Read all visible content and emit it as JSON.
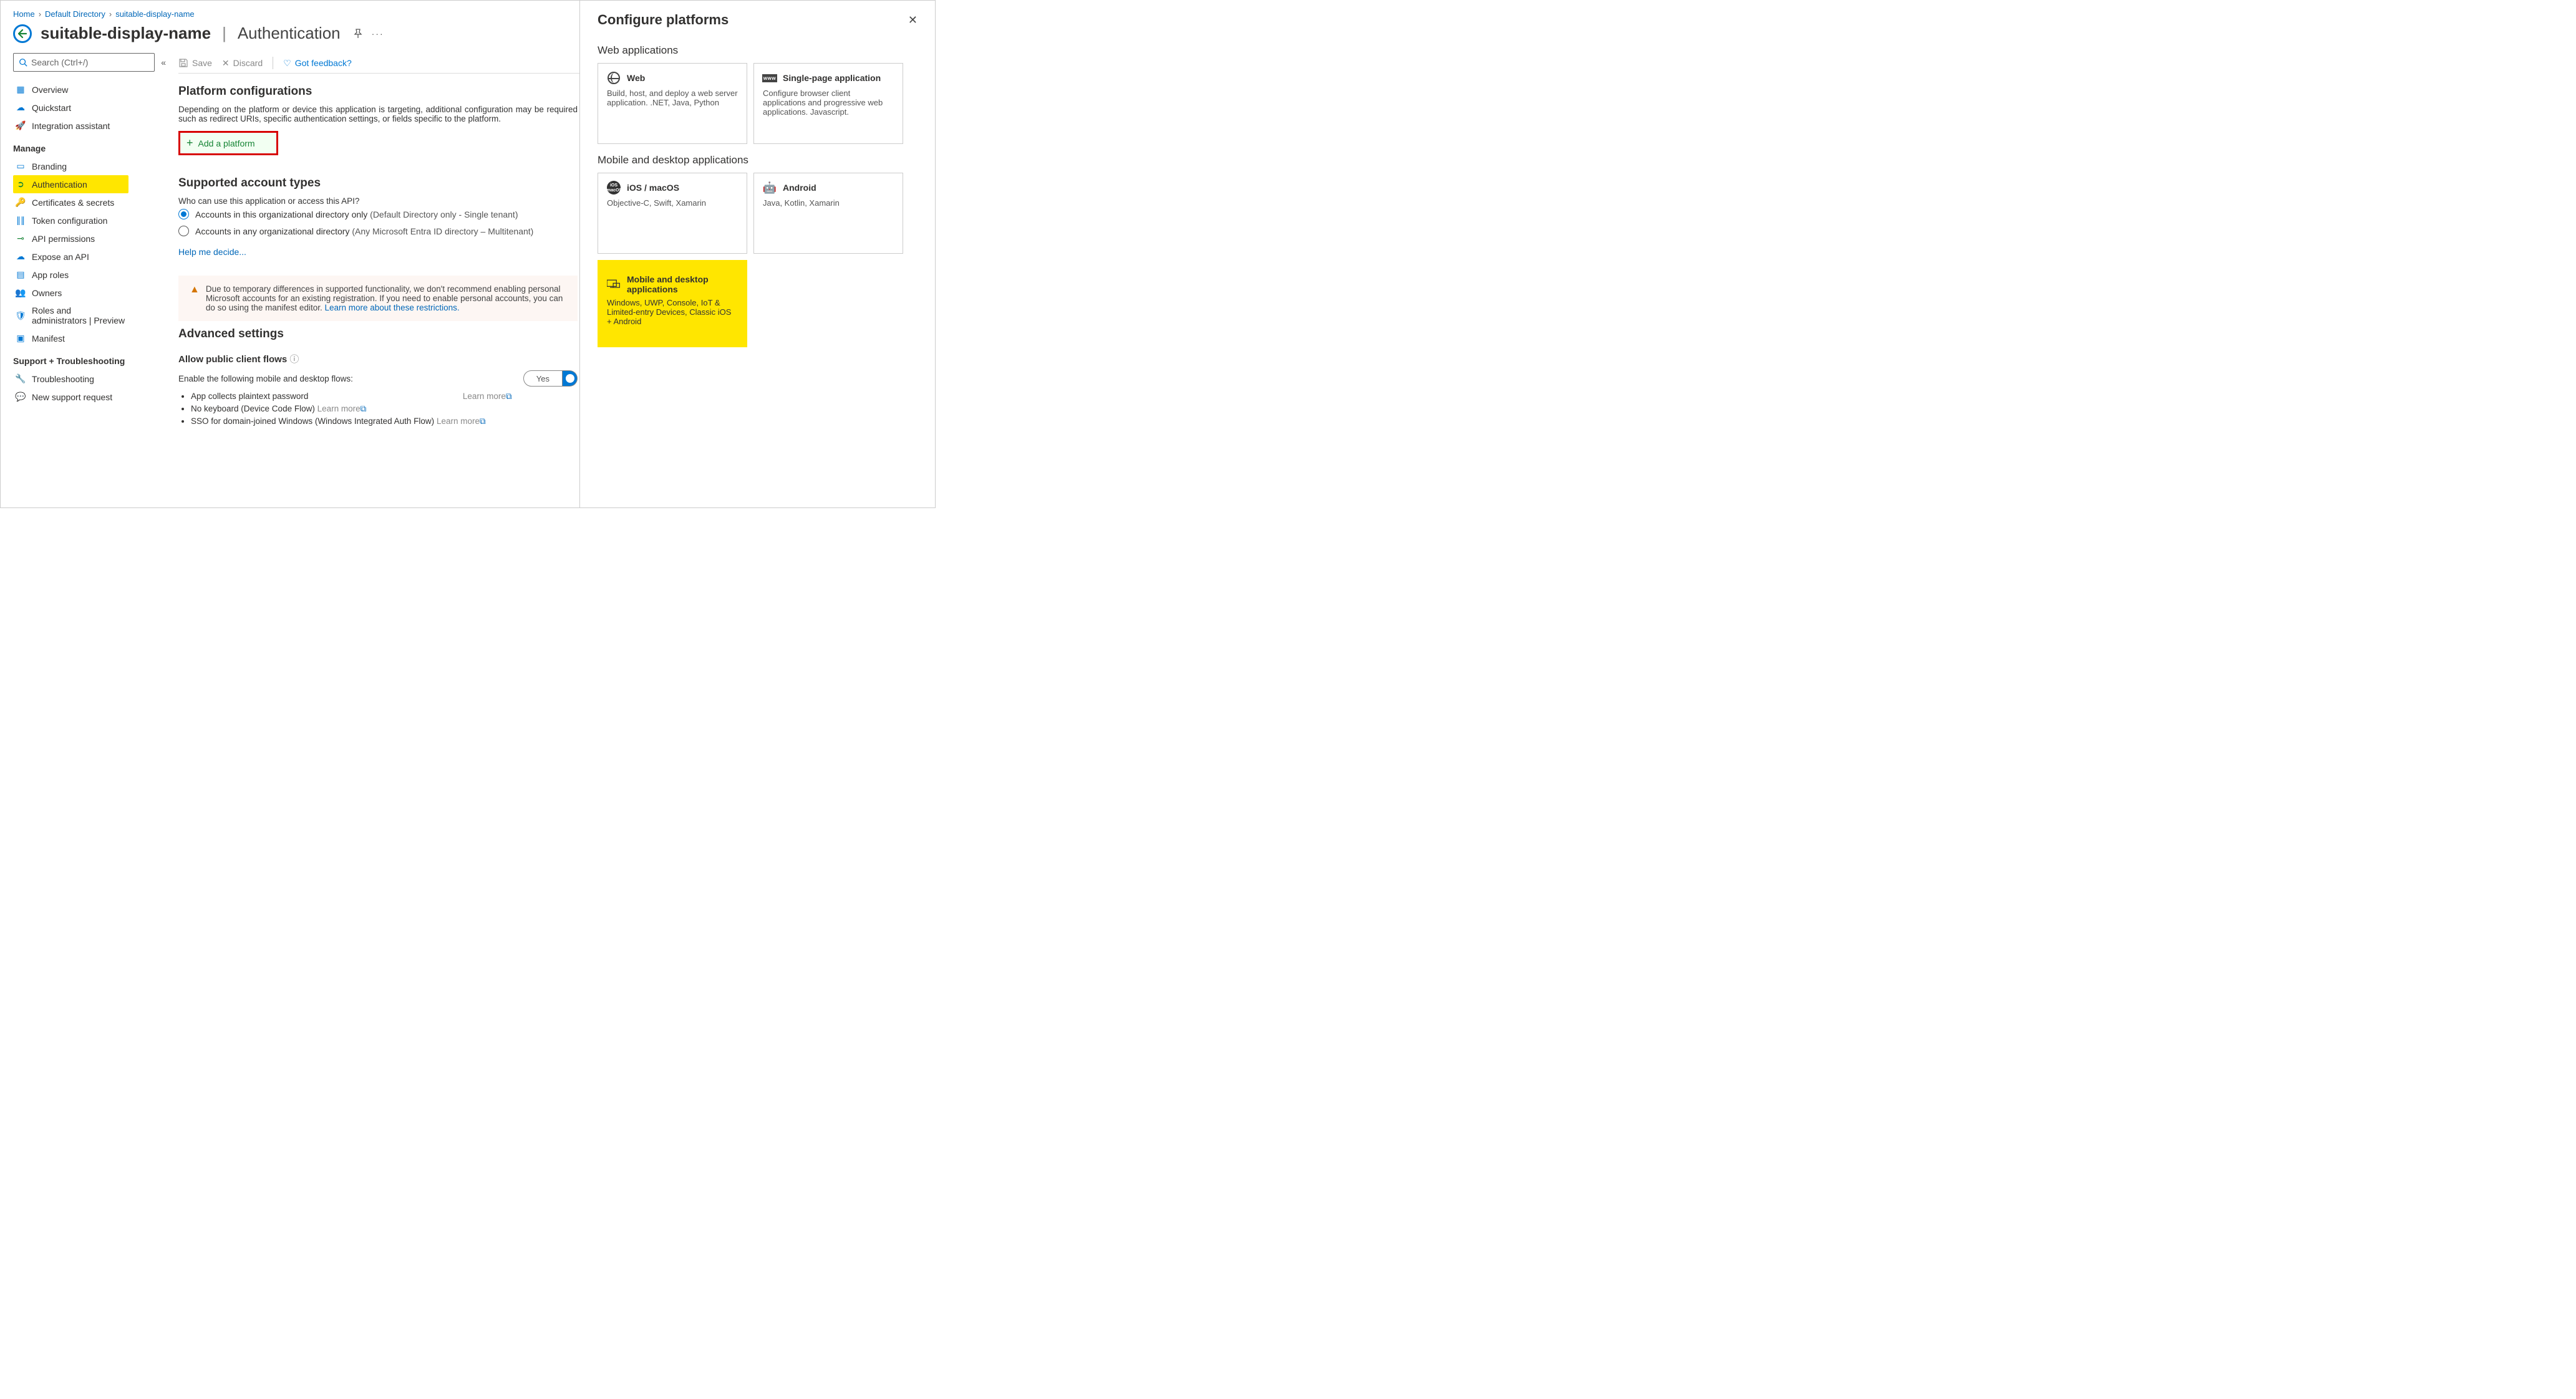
{
  "breadcrumb": {
    "home": "Home",
    "dir": "Default Directory",
    "app": "suitable-display-name"
  },
  "title": {
    "name": "suitable-display-name",
    "section": "Authentication"
  },
  "search": {
    "placeholder": "Search (Ctrl+/)"
  },
  "toolbar": {
    "save": "Save",
    "discard": "Discard",
    "feedback": "Got feedback?"
  },
  "sidebar": {
    "overview": "Overview",
    "quickstart": "Quickstart",
    "integration": "Integration assistant",
    "sec_manage": "Manage",
    "branding": "Branding",
    "auth": "Authentication",
    "certs": "Certificates & secrets",
    "tokencfg": "Token configuration",
    "apiperm": "API permissions",
    "expose": "Expose an API",
    "approles": "App roles",
    "owners": "Owners",
    "roles": "Roles and administrators | Preview",
    "manifest": "Manifest",
    "sec_support": "Support + Troubleshooting",
    "trouble": "Troubleshooting",
    "support": "New support request"
  },
  "platform": {
    "h": "Platform configurations",
    "p": "Depending on the platform or device this application is targeting, additional configuration may be required such as redirect URIs, specific authentication settings, or fields specific to the platform.",
    "add": "Add a platform"
  },
  "accounts": {
    "h": "Supported account types",
    "q": "Who can use this application or access this API?",
    "opt1": "Accounts in this organizational directory only",
    "opt1b": "(Default Directory only - Single tenant)",
    "opt2": "Accounts in any organizational directory",
    "opt2b": "(Any Microsoft Entra ID directory – Multitenant)",
    "help": "Help me decide..."
  },
  "warn": {
    "text": "Due to temporary differences in supported functionality, we don't recommend enabling personal Microsoft accounts for an existing registration. If you need to enable personal accounts, you can do so using the manifest editor.",
    "link": "Learn more about these restrictions."
  },
  "adv": {
    "h": "Advanced settings",
    "h2": "Allow public client flows",
    "p": "Enable the following mobile and desktop flows:",
    "yes": "Yes",
    "f1": "App collects plaintext password",
    "f2": "No keyboard (Device Code Flow)",
    "f3": "SSO for domain-joined Windows (Windows Integrated Auth Flow)",
    "learn": "Learn more"
  },
  "flyout": {
    "title": "Configure platforms",
    "sec_web": "Web applications",
    "web_t": "Web",
    "web_d": "Build, host, and deploy a web server application. .NET, Java, Python",
    "spa_t": "Single-page application",
    "spa_d": "Configure browser client applications and progressive web applications. Javascript.",
    "sec_mob": "Mobile and desktop applications",
    "ios_t": "iOS / macOS",
    "ios_d": "Objective-C, Swift, Xamarin",
    "and_t": "Android",
    "and_d": "Java, Kotlin, Xamarin",
    "desk_t": "Mobile and desktop applications",
    "desk_d": "Windows, UWP, Console, IoT & Limited-entry Devices, Classic iOS + Android"
  }
}
